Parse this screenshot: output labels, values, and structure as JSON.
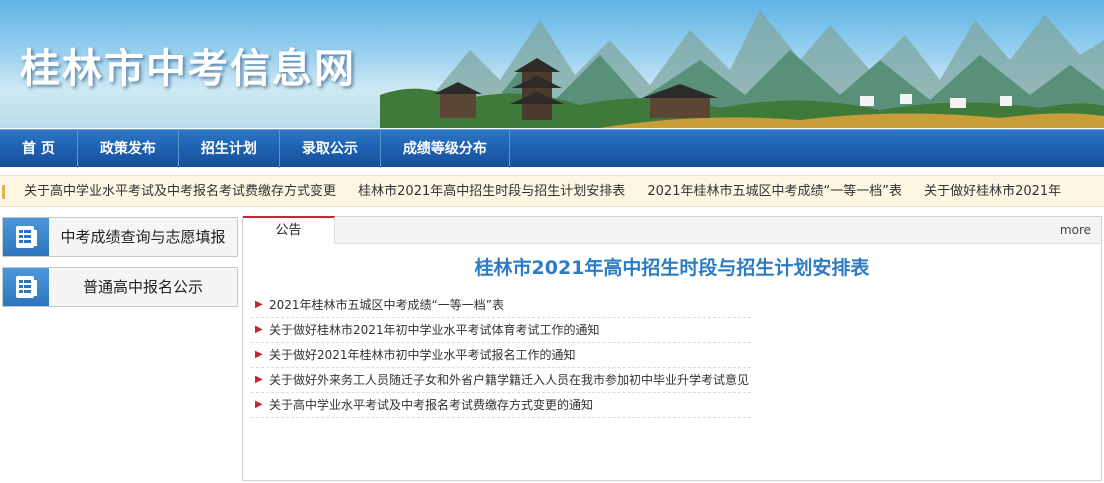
{
  "banner": {
    "site_title": "桂林市中考信息网"
  },
  "nav": {
    "items": [
      "首 页",
      "政策发布",
      "招生计划",
      "录取公示",
      "成绩等级分布"
    ]
  },
  "ticker": {
    "items": [
      "关于高中学业水平考试及中考报名考试费缴存方式变更",
      "桂林市2021年高中招生时段与招生计划安排表",
      "2021年桂林市五城区中考成绩“一等一档”表",
      "关于做好桂林市2021年"
    ]
  },
  "sidebar": {
    "buttons": [
      {
        "label": "中考成绩查询与志愿填报"
      },
      {
        "label": "普通高中报名公示"
      }
    ]
  },
  "panel": {
    "tab_label": "公告",
    "more_label": "more",
    "headline": "桂林市2021年高中招生时段与招生计划安排表",
    "news": [
      "2021年桂林市五城区中考成绩“一等一档”表",
      "关于做好桂林市2021年初中学业水平考试体育考试工作的通知",
      "关于做好2021年桂林市初中学业水平考试报名工作的通知",
      "关于做好外来务工人员随迁子女和外省户籍学籍迁入人员在我市参加初中毕业升学考试意见",
      "关于高中学业水平考试及中考报名考试费缴存方式变更的通知"
    ]
  },
  "colors": {
    "nav_blue": "#1d5fae",
    "headline_blue": "#2b7bc5",
    "accent_red": "#c9252c",
    "ticker_bg": "#fdf6e3"
  },
  "icons": {
    "sidebar_icon": "document-list-icon",
    "list_bullet": "triangle-right-icon"
  }
}
